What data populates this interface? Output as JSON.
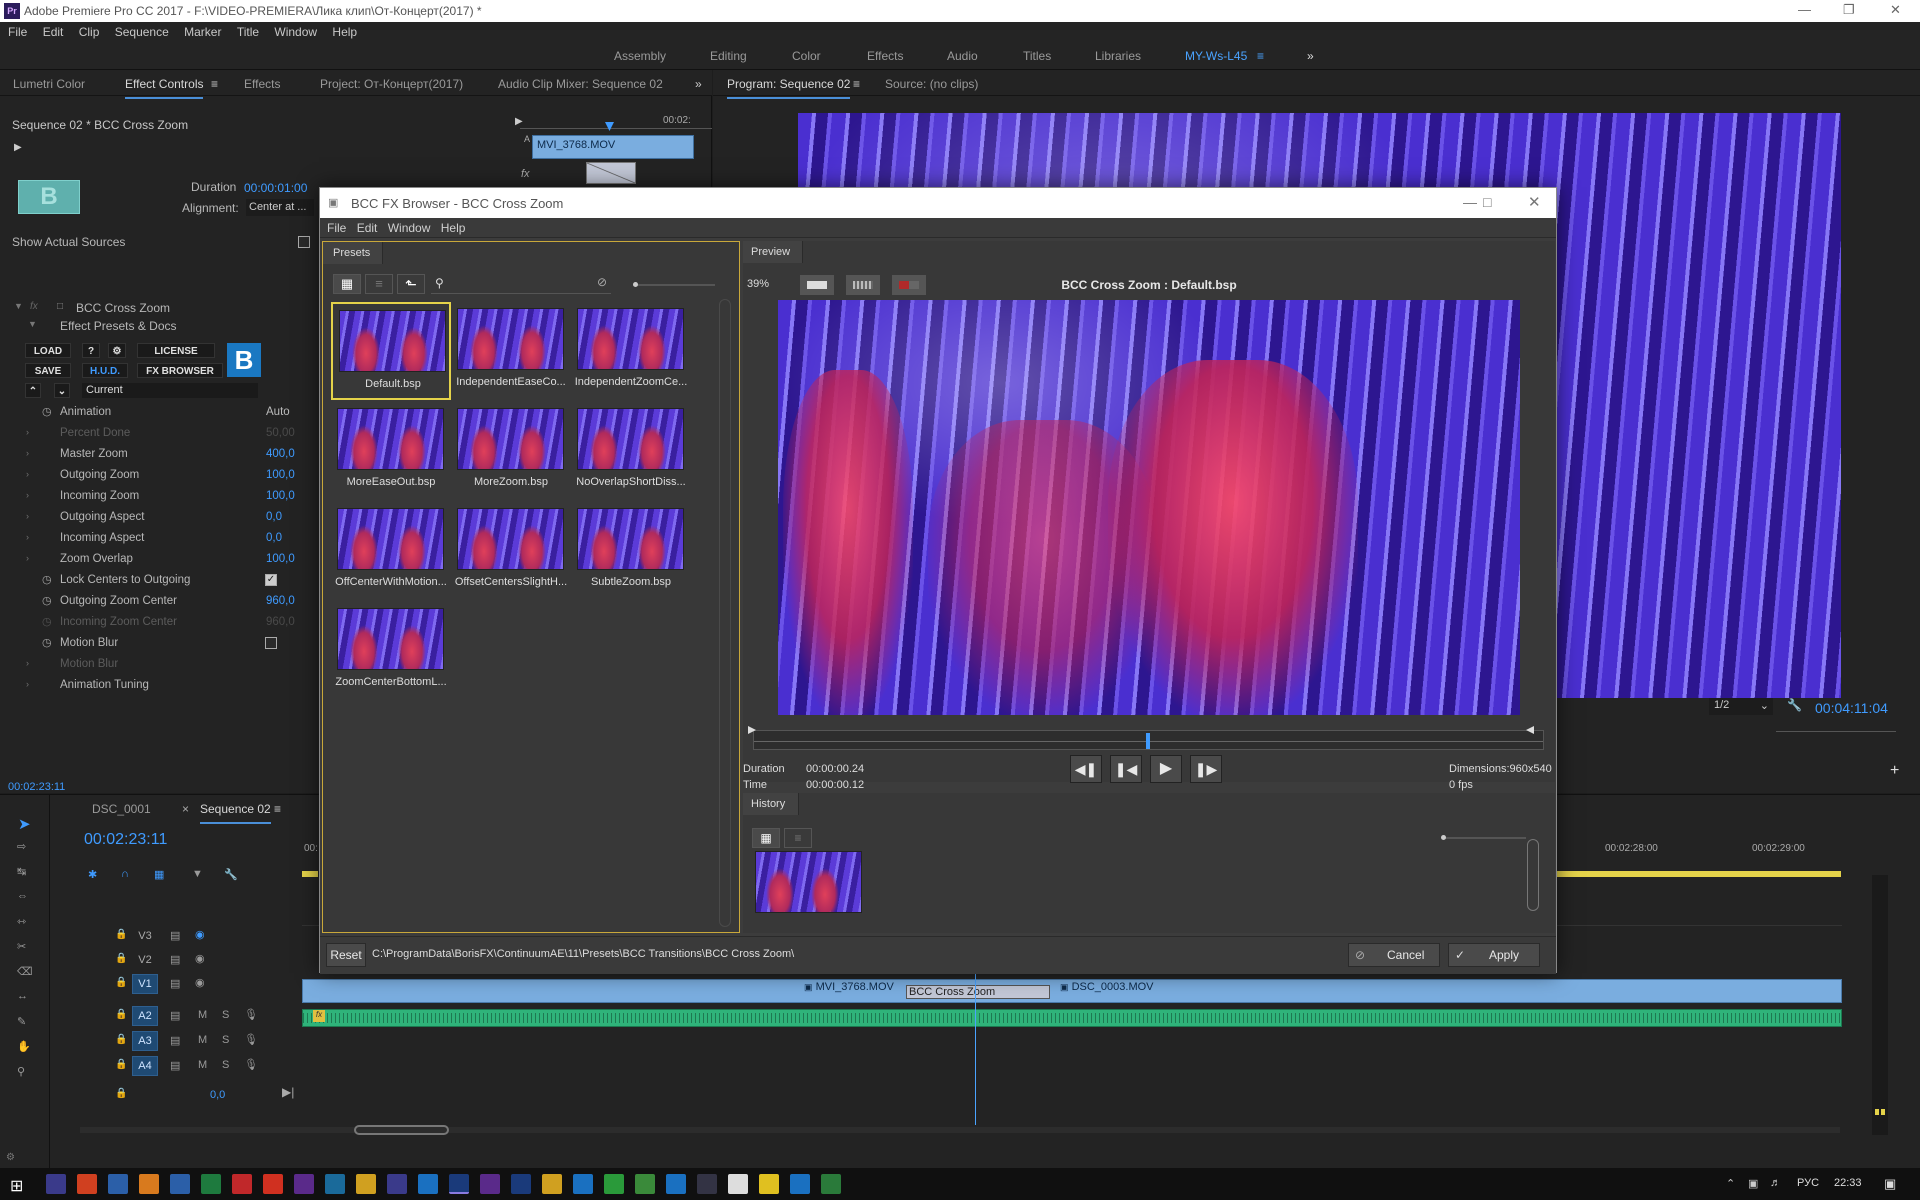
{
  "window": {
    "title": "Adobe Premiere Pro CC 2017 - F:\\VIDEO-PREMIERA\\Лика клип\\От-Концерт(2017) *"
  },
  "menu": [
    "File",
    "Edit",
    "Clip",
    "Sequence",
    "Marker",
    "Title",
    "Window",
    "Help"
  ],
  "workspaces": [
    "Assembly",
    "Editing",
    "Color",
    "Effects",
    "Audio",
    "Titles",
    "Libraries",
    "MY-Ws-L45"
  ],
  "left_tabs": [
    "Lumetri Color",
    "Effect Controls",
    "Effects",
    "Project: От-Концерт(2017)",
    "Audio Clip Mixer: Sequence 02"
  ],
  "effect_controls": {
    "header": "Sequence 02 * BCC Cross Zoom",
    "mini_time": "00:02:",
    "clip_name": "MVI_3768.MOV",
    "track_letter": "A",
    "fx_label": "fx",
    "duration_label": "Duration",
    "duration_value": "00:00:01:00",
    "alignment_label": "Alignment:",
    "alignment_value": "Center at ...",
    "show_sources": "Show Actual Sources",
    "effect_name": "BCC Cross Zoom",
    "presets_docs": "Effect Presets & Docs",
    "buttons": {
      "load": "LOAD",
      "help": "?",
      "license": "LICENSE",
      "save": "SAVE",
      "hud": "H.U.D.",
      "fx_browser": "FX BROWSER",
      "b_logo": "B"
    },
    "current": "Current",
    "props": [
      {
        "name": "Animation",
        "value": "Auto",
        "kind": "stopwatch",
        "dim": false
      },
      {
        "name": "Percent Done",
        "value": "50,00",
        "kind": "chev",
        "dim": true
      },
      {
        "name": "Master Zoom",
        "value": "400,0",
        "kind": "chev",
        "dim": false
      },
      {
        "name": "Outgoing Zoom",
        "value": "100,0",
        "kind": "chev",
        "dim": false
      },
      {
        "name": "Incoming Zoom",
        "value": "100,0",
        "kind": "chev",
        "dim": false
      },
      {
        "name": "Outgoing Aspect",
        "value": "0,0",
        "kind": "chev",
        "dim": false
      },
      {
        "name": "Incoming Aspect",
        "value": "0,0",
        "kind": "chev",
        "dim": false
      },
      {
        "name": "Zoom Overlap",
        "value": "100,0",
        "kind": "chev",
        "dim": false
      },
      {
        "name": "Lock Centers to Outgoing",
        "value": "",
        "kind": "check",
        "dim": false
      },
      {
        "name": "Outgoing Zoom Center",
        "value": "960,0",
        "kind": "stopwatch",
        "dim": false
      },
      {
        "name": "Incoming Zoom Center",
        "value": "960,0",
        "kind": "none",
        "dim": true
      },
      {
        "name": "Motion Blur",
        "value": "",
        "kind": "checkbox",
        "dim": false
      },
      {
        "name": "Motion Blur",
        "value": "",
        "kind": "chev",
        "dim": true
      },
      {
        "name": "Animation Tuning",
        "value": "",
        "kind": "chev",
        "dim": false
      }
    ],
    "bottom_time": "00:02:23:11"
  },
  "program": {
    "tab": "Program: Sequence 02",
    "source_tab": "Source: (no clips)",
    "resolution": "1/2",
    "timecode": "00:04:11:04"
  },
  "dialog": {
    "title": "BCC FX Browser - BCC Cross Zoom",
    "menu": [
      "File",
      "Edit",
      "Window",
      "Help"
    ],
    "presets_tab": "Presets",
    "preview_tab": "Preview",
    "zoom": "39%",
    "preview_title": "BCC Cross Zoom : Default.bsp",
    "presets": [
      "Default.bsp",
      "IndependentEaseCo...",
      "IndependentZoomCe...",
      "MoreEaseOut.bsp",
      "MoreZoom.bsp",
      "NoOverlapShortDiss...",
      "OffCenterWithMotion...",
      "OffsetCentersSlightH...",
      "SubtleZoom.bsp",
      "ZoomCenterBottomL..."
    ],
    "duration_label": "Duration",
    "duration_value": "00:00:00.24",
    "time_label": "Time",
    "time_value": "00:00:00.12",
    "dimensions": "Dimensions:960x540",
    "fps": "0 fps",
    "history_tab": "History",
    "reset": "Reset",
    "path": "C:\\ProgramData\\BorisFX\\ContinuumAE\\11\\Presets\\BCC Transitions\\BCC Cross Zoom\\",
    "cancel": "Cancel",
    "apply": "Apply"
  },
  "timeline": {
    "tab1": "DSC_0001",
    "tab2": "Sequence 02",
    "timecode": "00:02:23:11",
    "ruler_left": "00:",
    "ruler": [
      "00:02:28:00",
      "00:02:29:00"
    ],
    "tracks_video": [
      "V3",
      "V2",
      "V1"
    ],
    "tracks_audio": [
      "A2",
      "A3",
      "A4"
    ],
    "master_value": "0,0",
    "clip1": "MVI_3768.MOV",
    "transition": "BCC Cross Zoom",
    "clip2": "DSC_0003.MOV",
    "audio_fx": "fx",
    "m": "M",
    "s": "S"
  },
  "taskbar": {
    "lang": "РУС",
    "time": "22:33"
  },
  "colors": {
    "accent": "#3f9bff",
    "clip": "#7aaddf",
    "audio": "#2fb37a",
    "dialog_bg": "#3c3c3c"
  }
}
